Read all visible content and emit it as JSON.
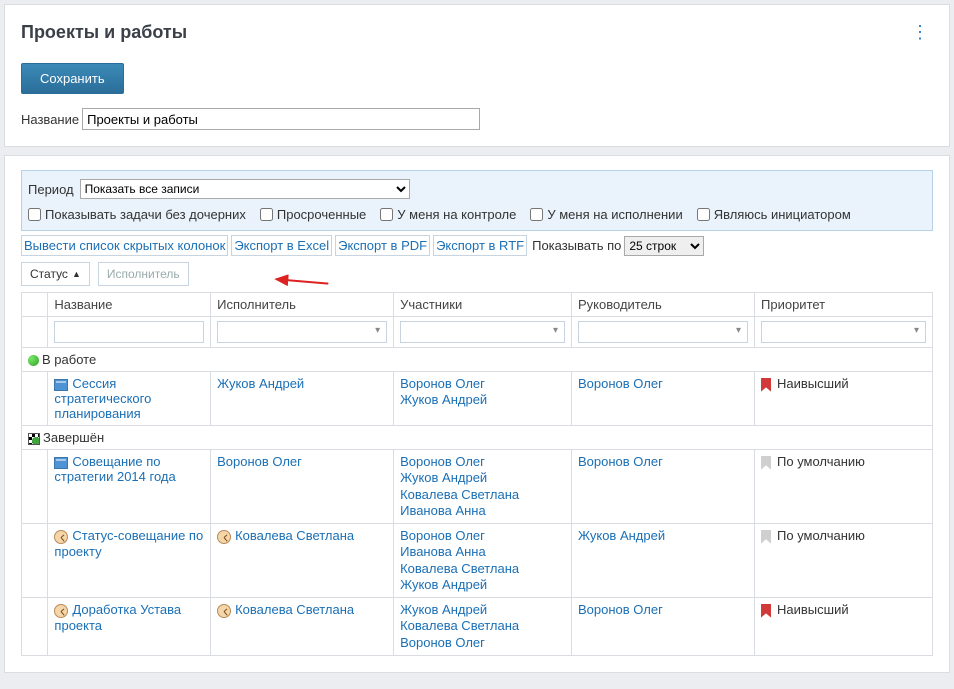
{
  "header": {
    "title": "Проекты и работы",
    "save_label": "Сохранить",
    "name_label": "Название",
    "name_value": "Проекты и работы"
  },
  "filters": {
    "period_label": "Период",
    "period_value": "Показать все записи",
    "cb_no_children": "Показывать задачи без дочерних",
    "cb_overdue": "Просроченные",
    "cb_my_control": "У меня на контроле",
    "cb_my_exec": "У меня на исполнении",
    "cb_initiator": "Являюсь инициатором"
  },
  "toolbar": {
    "hidden_cols": "Вывести список скрытых колонок",
    "export_excel": "Экспорт в Excel",
    "export_pdf": "Экспорт в PDF",
    "export_rtf": "Экспорт в RTF",
    "show_by_label": "Показывать по",
    "show_by_value": "25 строк"
  },
  "grouping": {
    "chip_status": "Статус",
    "chip_placeholder": "Исполнитель"
  },
  "columns": {
    "name": "Название",
    "executor": "Исполнитель",
    "participants": "Участники",
    "leader": "Руководитель",
    "priority": "Приоритет"
  },
  "groups": [
    {
      "status": "В работе",
      "status_kind": "active",
      "rows": [
        {
          "name": "Сессия стратегического планирования",
          "icon": "calendar",
          "executor": "Жуков Андрей",
          "participants": [
            "Воронов Олег",
            "Жуков Андрей"
          ],
          "leader": "Воронов Олег",
          "priority": "Наивысший",
          "priority_color": "red"
        }
      ]
    },
    {
      "status": "Завершён",
      "status_kind": "done",
      "rows": [
        {
          "name": "Совещание по стратегии 2014 года",
          "icon": "calendar",
          "executor": "Воронов Олег",
          "participants": [
            "Воронов Олег",
            "Жуков Андрей",
            "Ковалева Светлана",
            "Иванова Анна"
          ],
          "leader": "Воронов Олег",
          "priority": "По умолчанию",
          "priority_color": "gray"
        },
        {
          "name": "Статус-совещание по проекту",
          "icon": "clock",
          "executor": "Ковалева Светлана",
          "participants": [
            "Воронов Олег",
            "Иванова Анна",
            "Ковалева Светлана",
            "Жуков Андрей"
          ],
          "leader": "Жуков Андрей",
          "priority": "По умолчанию",
          "priority_color": "gray"
        },
        {
          "name": "Доработка Устава проекта",
          "icon": "clock",
          "executor": "Ковалева Светлана",
          "participants": [
            "Жуков Андрей",
            "Ковалева Светлана",
            "Воронов Олег"
          ],
          "leader": "Воронов Олег",
          "priority": "Наивысший",
          "priority_color": "red"
        }
      ]
    }
  ]
}
